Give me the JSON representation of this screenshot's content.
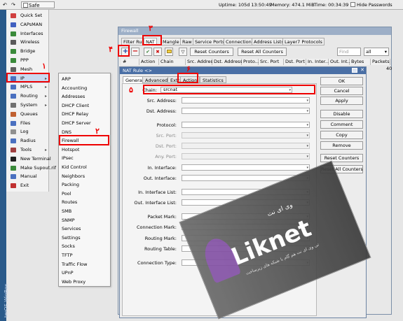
{
  "toolbar": {
    "undo_label": "↶",
    "redo_label": "↷",
    "safe_mode_label": "Safe Mode",
    "uptime": "Uptime: 105d 13:50:49",
    "memory": "Memory: 474.1 MiB",
    "time": "Time: 00:34:39",
    "hide_passwords_label": "Hide Passwords"
  },
  "brand_strip": "terOS WinBox",
  "left_menu": {
    "items": [
      {
        "label": "Quick Set",
        "icon": "quickset-icon",
        "color": "#d04040"
      },
      {
        "label": "CAPsMAN",
        "icon": "capsman-icon",
        "color": "#4060c0"
      },
      {
        "label": "Interfaces",
        "icon": "interfaces-icon",
        "color": "#3a8a3a"
      },
      {
        "label": "Wireless",
        "icon": "wireless-icon",
        "color": "#5a5a5a"
      },
      {
        "label": "Bridge",
        "icon": "bridge-icon",
        "color": "#3a8a3a"
      },
      {
        "label": "PPP",
        "icon": "ppp-icon",
        "color": "#3a8a3a"
      },
      {
        "label": "Mesh",
        "icon": "mesh-icon",
        "color": "#606060"
      },
      {
        "label": "IP",
        "icon": "ip-icon",
        "color": "#4a70c0",
        "arrow": "▸"
      },
      {
        "label": "MPLS",
        "icon": "mpls-icon",
        "color": "#4a70c0",
        "arrow": "▸"
      },
      {
        "label": "Routing",
        "icon": "routing-icon",
        "color": "#4a70c0",
        "arrow": "▸"
      },
      {
        "label": "System",
        "icon": "system-icon",
        "color": "#707070",
        "arrow": "▸"
      },
      {
        "label": "Queues",
        "icon": "queues-icon",
        "color": "#c06030"
      },
      {
        "label": "Files",
        "icon": "files-icon",
        "color": "#4a70c0"
      },
      {
        "label": "Log",
        "icon": "log-icon",
        "color": "#909090"
      },
      {
        "label": "Radius",
        "icon": "radius-icon",
        "color": "#4a70c0"
      },
      {
        "label": "Tools",
        "icon": "tools-icon",
        "color": "#a04040",
        "arrow": "▸"
      },
      {
        "label": "New Terminal",
        "icon": "terminal-icon",
        "color": "#202020"
      },
      {
        "label": "Make Supout.rif",
        "icon": "supout-icon",
        "color": "#3a8a3a"
      },
      {
        "label": "Manual",
        "icon": "manual-icon",
        "color": "#4a70c0"
      },
      {
        "label": "Exit",
        "icon": "exit-icon",
        "color": "#c03030"
      }
    ]
  },
  "ip_submenu": {
    "items": [
      "ARP",
      "Accounting",
      "Addresses",
      "DHCP Client",
      "DHCP Relay",
      "DHCP Server",
      "DNS",
      "Firewall",
      "Hotspot",
      "IPsec",
      "Kid Control",
      "Neighbors",
      "Packing",
      "Pool",
      "Routes",
      "SMB",
      "SNMP",
      "Services",
      "Settings",
      "Socks",
      "TFTP",
      "Traffic Flow",
      "UPnP",
      "Web Proxy"
    ]
  },
  "firewall": {
    "title": "Firewall",
    "tabs": [
      "Filter Rules",
      "NAT",
      "Mangle",
      "Raw",
      "Service Ports",
      "Connections",
      "Address Lists",
      "Layer7 Protocols"
    ],
    "reset_counters": "Reset Counters",
    "reset_all_counters": "Reset All Counters",
    "find_placeholder": "Find",
    "filter_value": "all",
    "columns": [
      "#",
      "Action",
      "Chain",
      "Src. Address",
      "Dst. Address",
      "Proto...",
      "Src. Port",
      "Dst. Port",
      "In. Inter...",
      "Out. Int...",
      "Bytes",
      "Packets"
    ],
    "row_value": "40"
  },
  "nat_rule": {
    "title": "NAT Rule <>",
    "tabs": [
      "General",
      "Advanced",
      "Extra",
      "Action",
      "Statistics"
    ],
    "fields": [
      {
        "label": "Chain:",
        "value": "srcnat"
      },
      {
        "label": "Src. Address:",
        "value": ""
      },
      {
        "label": "Dst. Address:",
        "value": ""
      },
      {
        "label": "Protocol:",
        "value": ""
      },
      {
        "label": "Src. Port:",
        "value": ""
      },
      {
        "label": "Dst. Port:",
        "value": ""
      },
      {
        "label": "Any. Port:",
        "value": ""
      },
      {
        "label": "In. Interface:",
        "value": ""
      },
      {
        "label": "Out. Interface:",
        "value": ""
      },
      {
        "label": "In. Interface List:",
        "value": ""
      },
      {
        "label": "Out. Interface List:",
        "value": ""
      },
      {
        "label": "Packet Mark:",
        "value": ""
      },
      {
        "label": "Connection Mark:",
        "value": ""
      },
      {
        "label": "Routing Mark:",
        "value": ""
      },
      {
        "label": "Routing Table:",
        "value": ""
      },
      {
        "label": "Connection Type:",
        "value": ""
      }
    ],
    "buttons": [
      "OK",
      "Cancel",
      "Apply",
      "Disable",
      "Comment",
      "Copy",
      "Remove",
      "Reset Counters",
      "Reset All Counters"
    ]
  },
  "annotations": [
    "۱",
    "۲",
    "۳",
    "۴",
    "۵",
    "۶"
  ],
  "watermark": {
    "brand": "Liknet",
    "persian_title": "وی ای نت",
    "tagline": "تی وی ای نت هم گام با شبکه های زیرساخت"
  },
  "colors": {
    "annotation_red": "#e00000",
    "title_bar": "#4a6fa5",
    "selected_menu": "#c9d8ef"
  }
}
